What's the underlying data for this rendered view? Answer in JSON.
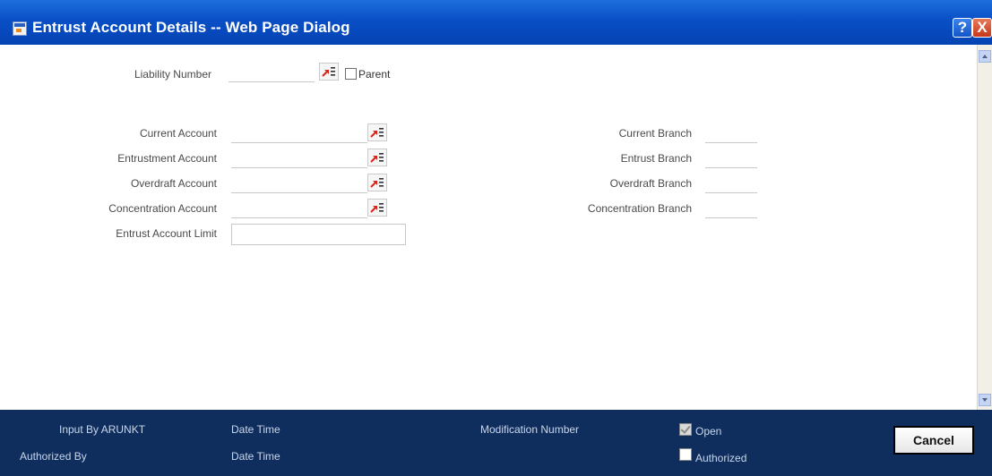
{
  "window": {
    "title": "Entrust Account Details -- Web Page Dialog",
    "help_label": "?",
    "close_label": "X"
  },
  "form": {
    "liability_number_label": "Liability Number",
    "parent_label": "Parent",
    "accounts": [
      {
        "label": "Current Account",
        "branch_label": "Current Branch"
      },
      {
        "label": "Entrustment Account",
        "branch_label": "Entrust Branch"
      },
      {
        "label": "Overdraft Account",
        "branch_label": "Overdraft Branch"
      },
      {
        "label": "Concentration Account",
        "branch_label": "Concentration Branch"
      }
    ],
    "limit_label": "Entrust Account Limit"
  },
  "footer": {
    "input_by": "Input By ARUNKT",
    "authorized_by": "Authorized By",
    "date_time_1": "Date Time",
    "date_time_2": "Date Time",
    "modification_number": "Modification Number",
    "open_label": "Open",
    "open_checked": true,
    "authorized_label": "Authorized",
    "authorized_checked": false,
    "cancel_label": "Cancel"
  },
  "colors": {
    "titlebar": "#0a4fc6",
    "footer": "#0f2e5d",
    "lov_icon_red": "#d8261c"
  }
}
